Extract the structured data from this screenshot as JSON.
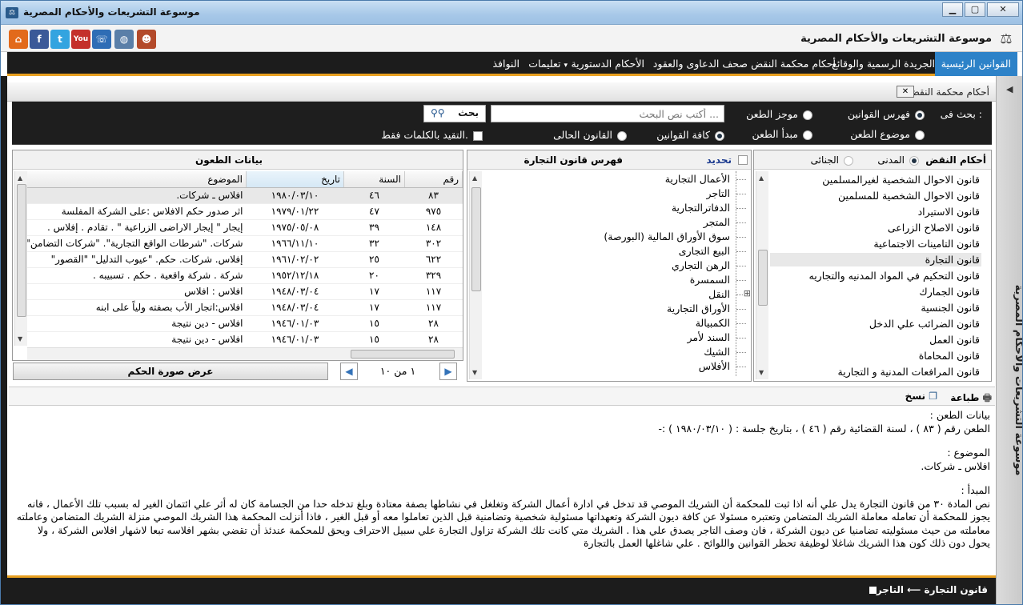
{
  "window": {
    "title": "موسوعة التشريعات والأحكام المصرية",
    "app_title": "موسوعة التشريعات والأحكام المصرية",
    "min": "▁",
    "max": "▢",
    "close": "✕"
  },
  "toolbar_icons": [
    {
      "name": "home-icon",
      "glyph": "⌂",
      "color": "#e26a1b"
    },
    {
      "name": "facebook-icon",
      "glyph": "f",
      "color": "#3b5998"
    },
    {
      "name": "twitter-icon",
      "glyph": "t",
      "color": "#33a4e0"
    },
    {
      "name": "youtube-icon",
      "glyph": "You",
      "color": "#c4302b"
    },
    {
      "name": "phone-icon",
      "glyph": "☏",
      "color": "#2f6db5"
    },
    {
      "name": "globe-icon",
      "glyph": "◍",
      "color": "#5a7fa8"
    },
    {
      "name": "user-icon",
      "glyph": "☻",
      "color": "#b34a2a"
    }
  ],
  "menu": [
    "القوانين الرئيسية",
    "الجريدة الرسمية والوقائع",
    "أحكام محكمة النقض",
    "صحف الدعاوى والعقود",
    "الأحكام الدستورية",
    "تعليمات",
    "النوافذ"
  ],
  "menu_dropdown_arrow": "▾",
  "side_label": "موسوعة التشريعات والأحكام المصرية",
  "panel": {
    "title": "أحكام محكمة النقض",
    "close": "✕"
  },
  "search": {
    "label": "بحث فى :",
    "options_row1": [
      {
        "label": "فهرس القوانين",
        "checked": true
      },
      {
        "label": "موجز الطعن",
        "checked": false
      }
    ],
    "options_row2": [
      {
        "label": "موضوع الطعن",
        "checked": false
      },
      {
        "label": "مبدأ الطعن",
        "checked": false
      }
    ],
    "placeholder": "أكتب نص البحث ...",
    "button": "بحث",
    "scope": [
      {
        "label": "كافة القوانين",
        "checked": true
      },
      {
        "label": "القانون الحالى",
        "checked": false
      }
    ],
    "exact_only": "التقيد بالكلمات فقط."
  },
  "law_list": {
    "tabs": [
      {
        "label": "أحكام النقض"
      },
      {
        "label": "المدنى",
        "checked": true
      },
      {
        "label": "الجنائى",
        "checked": false
      }
    ],
    "items": [
      "قانون الاحوال الشخصية لغيرالمسلمين",
      "قانون الاحوال الشخصية للمسلمين",
      "قانون الاستيراد",
      "قانون الاصلاح الزراعى",
      "قانون التامينات الاجتماعية",
      "قانون التجارة",
      "قانون التحكيم في المواد المدنيه والتجاريه",
      "قانون الجمارك",
      "قانون الجنسية",
      "قانون الضرائب علي الدخل",
      "قانون العمل",
      "قانون المحاماة",
      "قانون المرافعات المدنية و التجارية"
    ],
    "selected": 5
  },
  "tree": {
    "title": "فهرس قانون التجارة",
    "select_label": "تحديد",
    "nodes": [
      "الأعمال التجارية",
      "التاجر",
      "الدفاترالتجارية",
      "المتجر",
      "سوق الأوراق المالية (البورصة)",
      "البيع التجارى",
      "الرهن التجاري",
      "السمسرة",
      "النقل",
      "الأوراق التجارية",
      "الكمبيالة",
      "السند لأمر",
      "الشيك",
      "الأفلاس"
    ],
    "expandable": 8
  },
  "grid": {
    "title": "بيانات الطعون",
    "columns": [
      "رقم",
      "السنة",
      "تاريخ",
      "الموضوع"
    ],
    "rows": [
      [
        "٨٣",
        "٤٦",
        "١٩٨٠/٠٣/١٠",
        "افلاس ـ شركات."
      ],
      [
        "٩٧٥",
        "٤٧",
        "١٩٧٩/٠١/٢٢",
        "اثر صدور حكم الافلاس :على الشركة المفلسة"
      ],
      [
        "١٤٨",
        "٣٩",
        "١٩٧٥/٠٥/٠٨",
        "إيجار \" إيجار الاراضى الزراعية \" . تقادم . إفلاس ."
      ],
      [
        "٣٠٢",
        "٣٢",
        "١٩٦٦/١١/١٠",
        "شركات. \"شرطات الواقع التجارية\". \"شركات التضامن\""
      ],
      [
        "٦٢٢",
        "٢٥",
        "١٩٦١/٠٢/٠٢",
        "إفلاس. شركات. حكم. \"عيوب التدليل\" \"القصور\""
      ],
      [
        "٣٢٩",
        "٢٠",
        "١٩٥٢/١٢/١٨",
        "شركة . شركة واقعية . حكم . تسبيبه ."
      ],
      [
        "١١٧",
        "١٧",
        "١٩٤٨/٠٣/٠٤",
        "افلاس : افلاس"
      ],
      [
        "١١٧",
        "١٧",
        "١٩٤٨/٠٣/٠٤",
        "افلاس:اتجار الأب بصفته ولياً على ابنه"
      ],
      [
        "٢٨",
        "١٥",
        "١٩٤٦/٠١/٠٣",
        "افلاس - دين نتيجة"
      ],
      [
        "٢٨",
        "١٥",
        "١٩٤٦/٠١/٠٣",
        "افلاس - دين نتيجة"
      ]
    ],
    "selected": 0
  },
  "pager": {
    "text": "١ من ١٠",
    "prev": "◀",
    "next": "▶",
    "image_button": "عرض صورة الحكم"
  },
  "print_bar": {
    "print": "طباعة",
    "copy": "نسخ"
  },
  "detail": {
    "h1": "بيانات الطعن :",
    "l1": "الطعن رقم   ( ٨٣ )  ، لسنة القضائية رقم  ( ٤٦ )  ، بتاريخ جلسة :   ( ١٩٨٠/٠٣/١٠ )  :-",
    "h2": "الموضوع :",
    "l2": "افلاس ـ شركات.",
    "h3": "المبدأ :",
    "p1": "نص   المادة  ٣٠  من قانون التجارة يدل علي أنه اذا ثبت للمحكمة أن الشريك الموصي قد تدخل في ادارة أعمال الشركة وتغلغل في نشاطها بصفة معتادة وبلغ تدخله حدا من الجسامة كان له أثر علي ائتمان الغير له بسبب تلك الأعمال ،  فانه يجوز للمحكمة أن تعامله معاملة الشريك المتضامن وتعتبره مسئولا عن كافة ديون الشركة وتعهداتها مسئولية شخصية وتضامنية قبل الذين تعاملوا معه أو قبل الغير  ،   فاذا أنزلت المحكمة هذا الشريك الموصي منزلة الشريك المتضامن وعاملته معاملته من حيث مسئوليته تضامنيا عن ديون الشركة  ،   فان وصف التاجر يصدق علي هذا .  الشريك متي كانت تلك الشركة تزاول التجارة علي سبيل الاحتراف ويحق للمحكمة عندئذ أن تقضي بشهر افلاسه تبعا لاشهار افلاس   الشركة  ،  ولا يحول دون ذلك كون هذا الشريك شاغلا لوظيفة تحظر القوانين واللوائح  .  علي شاغلها العمل بالتجارة"
  },
  "status": {
    "text": "قانون التجارة ⟵ التاجر"
  }
}
